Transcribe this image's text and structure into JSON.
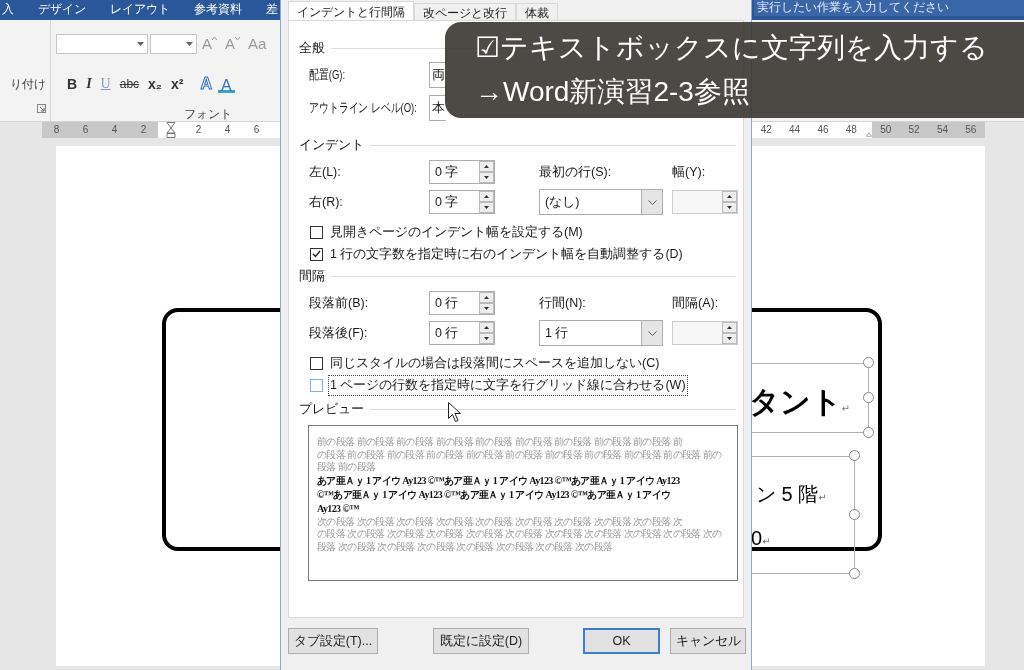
{
  "ribbon": {
    "tabs": [
      "入",
      "デザイン",
      "レイアウト",
      "参考資料",
      "差"
    ],
    "tell_me": {
      "placeholder": "実行したい作業を入力してください"
    },
    "clipboard": {
      "paste_label": "り付け"
    },
    "font_group": {
      "label": "フォント",
      "size_buttons": [
        {
          "label": "A",
          "kind": "grow"
        },
        {
          "label": "A",
          "kind": "shrink"
        },
        {
          "label": "Aa",
          "kind": "case"
        }
      ],
      "format_buttons": [
        {
          "label": "B",
          "kind": "bold"
        },
        {
          "label": "I",
          "kind": "italic"
        },
        {
          "label": "U",
          "kind": "underline"
        },
        {
          "label": "abc",
          "kind": "strike"
        },
        {
          "label": "x₂",
          "kind": "sub"
        },
        {
          "label": "x²",
          "kind": "sup"
        },
        {
          "label": "A",
          "kind": "effects"
        },
        {
          "label": "A",
          "kind": "color"
        }
      ]
    }
  },
  "ruler": {
    "left_ticks": [
      {
        "label": "8",
        "margin": true
      },
      {
        "label": "6",
        "margin": true
      },
      {
        "label": "4",
        "margin": true
      },
      {
        "label": "2",
        "margin": true
      },
      {
        "label": "2",
        "margin": false
      },
      {
        "label": "4",
        "margin": false
      },
      {
        "label": "6",
        "margin": false
      }
    ],
    "right_ticks": [
      {
        "label": "42",
        "margin": false
      },
      {
        "label": "44",
        "margin": false
      },
      {
        "label": "46",
        "margin": false
      },
      {
        "label": "48",
        "margin": false
      },
      {
        "label": "50",
        "margin": true
      },
      {
        "label": "52",
        "margin": true
      },
      {
        "label": "54",
        "margin": true
      },
      {
        "label": "56",
        "margin": true
      }
    ]
  },
  "document": {
    "text_boxes": [
      {
        "kind": "heading",
        "lines": [
          {
            "text": "タント",
            "mark": "↵"
          }
        ]
      },
      {
        "kind": "body",
        "lines": [
          {
            "text": "ン 5 階",
            "mark": "↵"
          },
          {
            "text": "0",
            "mark": "↵"
          }
        ]
      }
    ]
  },
  "dialog": {
    "tabs": [
      {
        "label": "インデントと行間隔",
        "selected": true
      },
      {
        "label": "改ページと改行",
        "selected": false
      },
      {
        "label": "体裁",
        "selected": false
      }
    ],
    "general": {
      "heading": "全般",
      "fields": [
        {
          "label": "配置(G):",
          "value": "両"
        },
        {
          "label": "アウトライン レベル(O):",
          "value": "本"
        }
      ]
    },
    "indent": {
      "heading": "インデント",
      "spinners": [
        {
          "label": "左(L):",
          "value": "0 字"
        },
        {
          "label": "右(R):",
          "value": "0 字"
        }
      ],
      "dropdown": {
        "label": "最初の行(S):",
        "value": "(なし)"
      },
      "amount": {
        "label": "幅(Y):",
        "disabled": true
      },
      "checkboxes": [
        {
          "label": "見開きページのインデント幅を設定する(M)",
          "checked": false,
          "focused": false
        },
        {
          "label": "1 行の文字数を指定時に右のインデント幅を自動調整する(D)",
          "checked": true,
          "focused": false
        }
      ]
    },
    "spacing": {
      "heading": "間隔",
      "spinners": [
        {
          "label": "段落前(B):",
          "value": "0 行"
        },
        {
          "label": "段落後(F):",
          "value": "0 行"
        }
      ],
      "dropdown": {
        "label": "行間(N):",
        "value": "1 行"
      },
      "amount": {
        "label": "間隔(A):",
        "disabled": true
      },
      "checkboxes": [
        {
          "label": "同じスタイルの場合は段落間にスペースを追加しない(C)",
          "checked": false,
          "focused": false
        },
        {
          "label": "1 ページの行数を指定時に文字を行グリッド線に合わせる(W)",
          "checked": false,
          "focused": true
        }
      ]
    },
    "preview": {
      "heading": "プレビュー",
      "previous_lines": [
        "前の段落 前の段落 前の段落 前の段落 前の段落 前の段落 前の段落 前の段落 前の段落 前",
        "の段落 前の段落 前の段落 前の段落 前の段落 前の段落 前の段落 前の段落 前の段落 前の段落 前の",
        "段落 前の段落"
      ],
      "sample_lines": [
        "あア亜Ａｙ 1 アイウ Ay123 ©™あア亜Ａｙ 1 アイウ Ay123 ©™あア亜Ａｙ 1 アイウ Ay123",
        "©™あア亜Ａｙ 1 アイウ Ay123 ©™あア亜Ａｙ 1 アイウ Ay123 ©™あア亜Ａｙ 1 アイウ",
        "Ay123 ©™"
      ],
      "next_lines": [
        "次の段落 次の段落 次の段落 次の段落 次の段落 次の段落 次の段落 次の段落 次の段落 次",
        "の段落 次の段落 次の段落 次の段落 次の段落 次の段落 次の段落 次の段落 次の段落 次の段落 次の",
        "段落 次の段落 次の段落 次の段落 次の段落 次の段落 次の段落 次の段落"
      ]
    },
    "buttons": [
      {
        "label": "タブ設定(T)...",
        "default": false
      },
      {
        "label": "既定に設定(D)",
        "default": false
      },
      {
        "label": "OK",
        "default": true
      },
      {
        "label": "キャンセル",
        "default": false
      }
    ]
  },
  "caption": {
    "lines": [
      "☑テキストボックスに文字列を入力する",
      "→Word新演習2-3参照"
    ]
  }
}
